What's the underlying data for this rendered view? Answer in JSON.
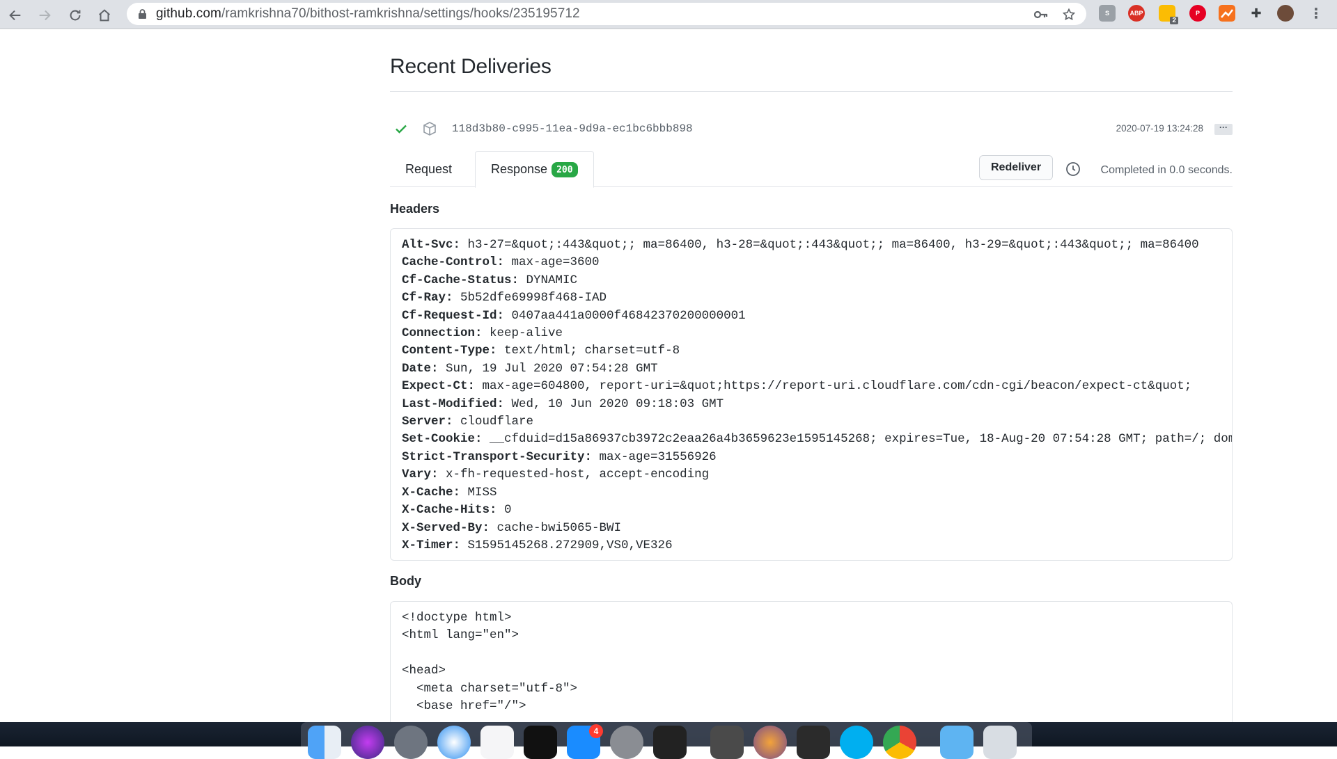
{
  "browser": {
    "url_domain": "github.com",
    "url_path": "/ramkrishna70/bithost-ramkrishna/settings/hooks/235195712",
    "extension_badge": "2"
  },
  "page": {
    "title": "Recent Deliveries",
    "delivery": {
      "guid": "118d3b80-c995-11ea-9d9a-ec1bc6bbb898",
      "timestamp": "2020-07-19 13:24:28",
      "more_label": "···"
    },
    "tabs": [
      {
        "label": "Request",
        "active": false
      },
      {
        "label": "Response",
        "active": true,
        "count": "200"
      }
    ],
    "redeliver_label": "Redeliver",
    "completed_text": "Completed in 0.0 seconds.",
    "headers_heading": "Headers",
    "headers": [
      {
        "name": "Alt-Svc:",
        "value": " h3-27=&quot;:443&quot;; ma=86400, h3-28=&quot;:443&quot;; ma=86400, h3-29=&quot;:443&quot;; ma=86400"
      },
      {
        "name": "Cache-Control:",
        "value": " max-age=3600"
      },
      {
        "name": "Cf-Cache-Status:",
        "value": " DYNAMIC"
      },
      {
        "name": "Cf-Ray:",
        "value": " 5b52dfe69998f468-IAD"
      },
      {
        "name": "Cf-Request-Id:",
        "value": " 0407aa441a0000f46842370200000001"
      },
      {
        "name": "Connection:",
        "value": " keep-alive"
      },
      {
        "name": "Content-Type:",
        "value": " text/html; charset=utf-8"
      },
      {
        "name": "Date:",
        "value": " Sun, 19 Jul 2020 07:54:28 GMT"
      },
      {
        "name": "Expect-Ct:",
        "value": " max-age=604800, report-uri=&quot;https://report-uri.cloudflare.com/cdn-cgi/beacon/expect-ct&quot;"
      },
      {
        "name": "Last-Modified:",
        "value": " Wed, 10 Jun 2020 09:18:03 GMT"
      },
      {
        "name": "Server:",
        "value": " cloudflare"
      },
      {
        "name": "Set-Cookie:",
        "value": " __cfduid=d15a86937cb3972c2eaa26a4b3659623e1595145268; expires=Tue, 18-Aug-20 07:54:28 GMT; path=/; dom"
      },
      {
        "name": "Strict-Transport-Security:",
        "value": " max-age=31556926"
      },
      {
        "name": "Vary:",
        "value": " x-fh-requested-host, accept-encoding"
      },
      {
        "name": "X-Cache:",
        "value": " MISS"
      },
      {
        "name": "X-Cache-Hits:",
        "value": " 0"
      },
      {
        "name": "X-Served-By:",
        "value": " cache-bwi5065-BWI"
      },
      {
        "name": "X-Timer:",
        "value": " S1595145268.272909,VS0,VE326"
      }
    ],
    "body_heading": "Body",
    "body_lines": [
      "<!doctype html>",
      "<html lang=\"en\">",
      "",
      "<head>",
      "  <meta charset=\"utf-8\">",
      "  <base href=\"/\">"
    ]
  },
  "dock": {
    "appstore_badge": "4"
  },
  "colors": {
    "success": "#28a745",
    "border": "#e1e4e8",
    "muted": "#586069"
  }
}
